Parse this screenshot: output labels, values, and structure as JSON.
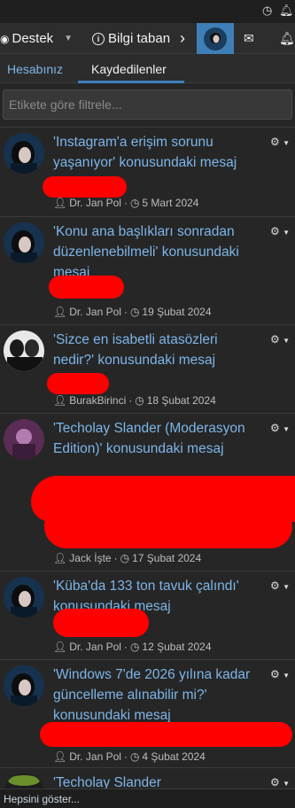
{
  "statusbar": {
    "icons": [
      "clock-icon",
      "bell-icon"
    ]
  },
  "nav": {
    "destek": "Destek",
    "bilgi": "Bilgi taban",
    "icons": [
      "support-icon",
      "info-icon",
      "chevron-right-icon",
      "envelope-icon",
      "bell-icon"
    ]
  },
  "tabs": {
    "account": "Hesabınız",
    "saved": "Kaydedilenler"
  },
  "filter": {
    "placeholder": "Etikete göre filtrele..."
  },
  "entries": [
    {
      "title": "'Instagram'a erişim sorunu yaşanıyor' konusundaki mesaj",
      "author": "Dr. Jan Pol",
      "date": "5 Mart 2024"
    },
    {
      "title": "'Konu ana başlıkları sonradan düzenlenebilmeli' konusundaki mesaj",
      "author": "Dr. Jan Pol",
      "date": "19 Şubat 2024"
    },
    {
      "title": "'Sizce en isabetli atasözleri nedir?' konusundaki mesaj",
      "author": "BurakBirinci",
      "date": "18 Şubat 2024"
    },
    {
      "title": "'Techolay Slander (Moderasyon Edition)' konusundaki mesaj",
      "author": "Jack İşte",
      "date": "17 Şubat 2024"
    },
    {
      "title": "'Küba'da 133 ton tavuk çalındı' konusundaki mesaj",
      "author": "Dr. Jan Pol",
      "date": "12 Şubat 2024"
    },
    {
      "title": "'Windows 7'de 2026 yılına kadar güncelleme alınabilir mi?' konusundaki mesaj",
      "author": "Dr. Jan Pol",
      "date": "4 Şubat 2024"
    },
    {
      "title": "'Techolay Slander",
      "author": "",
      "date": ""
    }
  ],
  "footer": {
    "show_all": "Hepsini göster..."
  },
  "colors": {
    "accent": "#3f7fb8",
    "link": "#7db5e8",
    "redaction": "#ff0000"
  }
}
